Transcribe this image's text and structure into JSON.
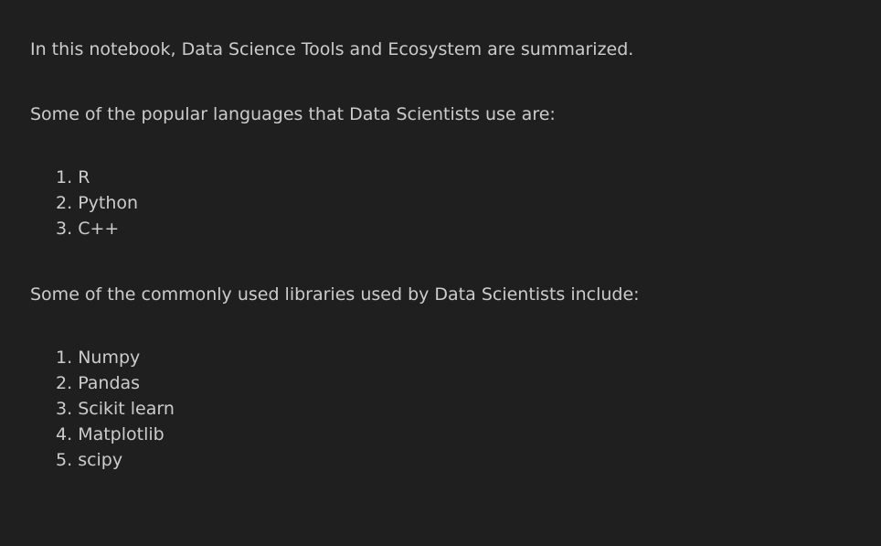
{
  "intro": "In this notebook, Data Science Tools and Ecosystem are summarized.",
  "languages_heading": "Some of the popular languages that Data Scientists use are:",
  "languages": [
    {
      "num": "1.",
      "label": "R"
    },
    {
      "num": "2.",
      "label": "Python"
    },
    {
      "num": "3.",
      "label": "C++"
    }
  ],
  "libraries_heading": "Some of the commonly used libraries used by Data Scientists include:",
  "libraries": [
    {
      "num": "1.",
      "label": "Numpy"
    },
    {
      "num": "2.",
      "label": "Pandas"
    },
    {
      "num": "3.",
      "label": "Scikit learn"
    },
    {
      "num": "4.",
      "label": "Matplotlib"
    },
    {
      "num": "5.",
      "label": "scipy"
    }
  ]
}
